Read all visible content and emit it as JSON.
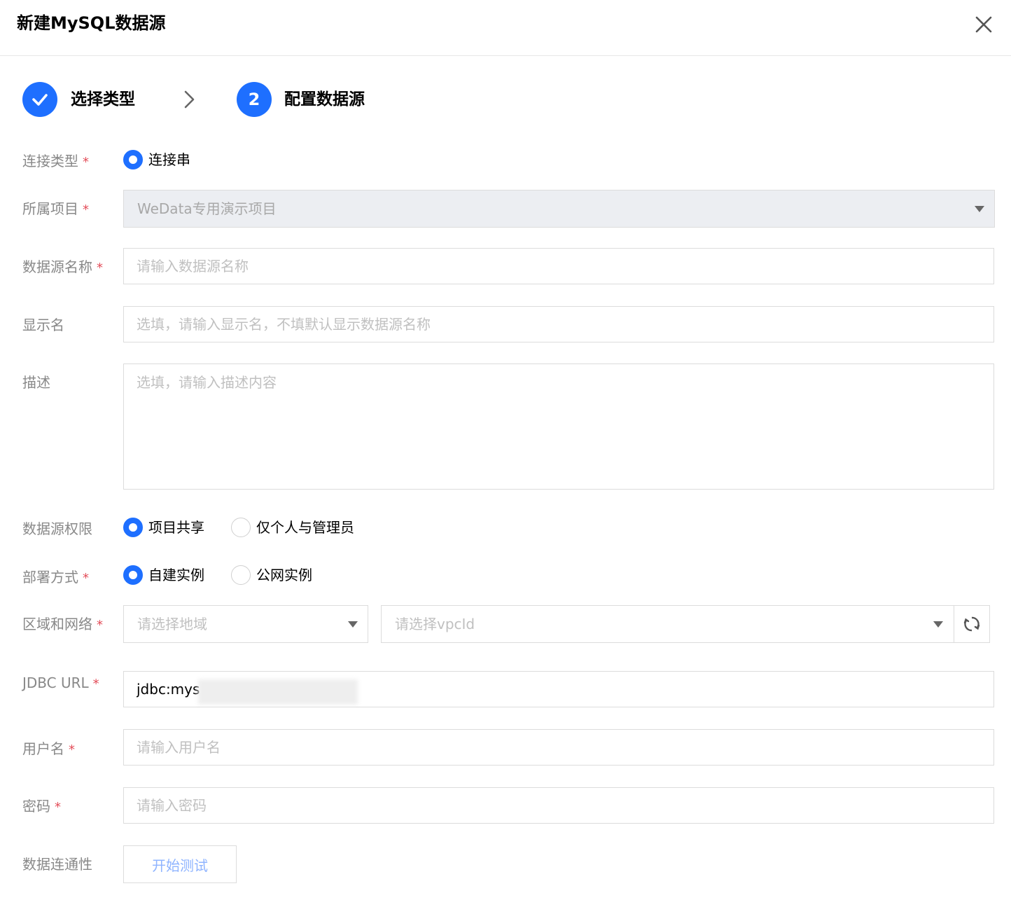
{
  "dialog": {
    "title": "新建MySQL数据源"
  },
  "steps": [
    {
      "label": "选择类型",
      "status": "done"
    },
    {
      "number": "2",
      "label": "配置数据源",
      "status": "current"
    }
  ],
  "form": {
    "connection_type": {
      "label": "连接类型",
      "options": [
        "连接串"
      ],
      "selected": "连接串"
    },
    "project": {
      "label": "所属项目",
      "value": "WeData专用演示项目",
      "disabled": true
    },
    "datasource_name": {
      "label": "数据源名称",
      "placeholder": "请输入数据源名称"
    },
    "display_name": {
      "label": "显示名",
      "placeholder": "选填，请输入显示名，不填默认显示数据源名称"
    },
    "description": {
      "label": "描述",
      "placeholder": "选填，请输入描述内容"
    },
    "permission": {
      "label": "数据源权限",
      "options": [
        "项目共享",
        "仅个人与管理员"
      ],
      "selected": "项目共享"
    },
    "deploy": {
      "label": "部署方式",
      "options": [
        "自建实例",
        "公网实例"
      ],
      "selected": "自建实例"
    },
    "region_network": {
      "label": "区域和网络",
      "region_placeholder": "请选择地域",
      "vpc_placeholder": "请选择vpcId"
    },
    "jdbc_url": {
      "label": "JDBC URL",
      "value": "jdbc:mys"
    },
    "username": {
      "label": "用户名",
      "placeholder": "请输入用户名"
    },
    "password": {
      "label": "密码",
      "placeholder": "请输入密码"
    },
    "connectivity": {
      "label": "数据连通性",
      "button": "开始测试"
    }
  },
  "colors": {
    "primary": "#1e6fff",
    "required": "#e34d59",
    "label": "#888888",
    "border": "#dcdcdc"
  }
}
